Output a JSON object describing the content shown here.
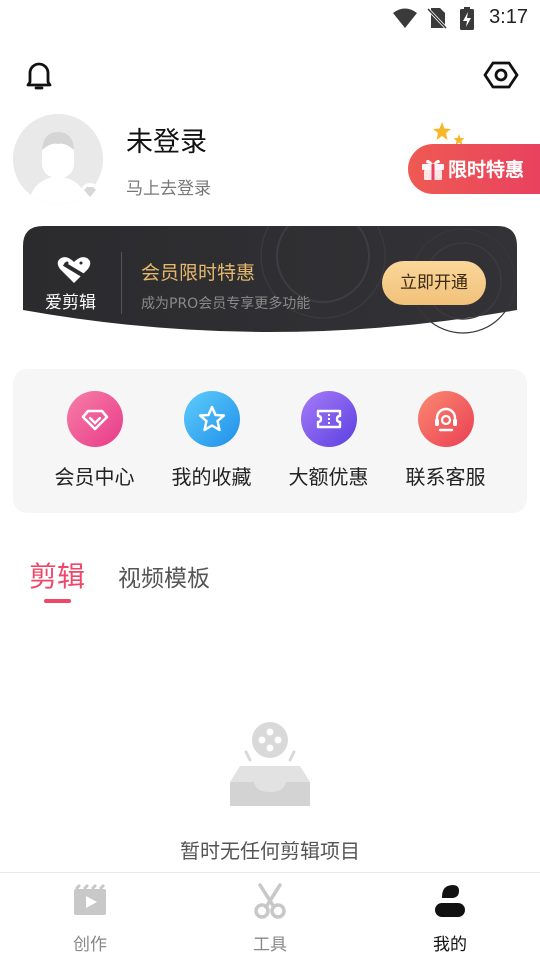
{
  "status_bar": {
    "time": "3:17"
  },
  "profile": {
    "username": "未登录",
    "login_prompt": "马上去登录"
  },
  "promo_pill": {
    "label": "限时特惠"
  },
  "vip_banner": {
    "brand": "爱剪辑",
    "title": "会员限时特惠",
    "subtitle": "成为PRO会员专享更多功能",
    "button": "立即开通"
  },
  "quick_actions": [
    {
      "label": "会员中心",
      "icon": "diamond-icon",
      "color": "#f04e94"
    },
    {
      "label": "我的收藏",
      "icon": "star-icon",
      "color": "#2fa6f2"
    },
    {
      "label": "大额优惠",
      "icon": "ticket-icon",
      "color": "#7d55f0"
    },
    {
      "label": "联系客服",
      "icon": "headset-icon",
      "color": "#f2595a"
    }
  ],
  "tabs": [
    {
      "label": "剪辑",
      "active": true
    },
    {
      "label": "视频模板",
      "active": false
    }
  ],
  "empty_state": {
    "text": "暂时无任何剪辑项目"
  },
  "bottom_nav": [
    {
      "label": "创作",
      "icon": "video-clapper-icon",
      "active": false
    },
    {
      "label": "工具",
      "icon": "scissors-icon",
      "active": false
    },
    {
      "label": "我的",
      "icon": "person-icon",
      "active": true
    }
  ],
  "colors": {
    "accent": "#f0466a",
    "vip_gold": "#e6b86d",
    "banner_dark": "#2a2a2c"
  }
}
